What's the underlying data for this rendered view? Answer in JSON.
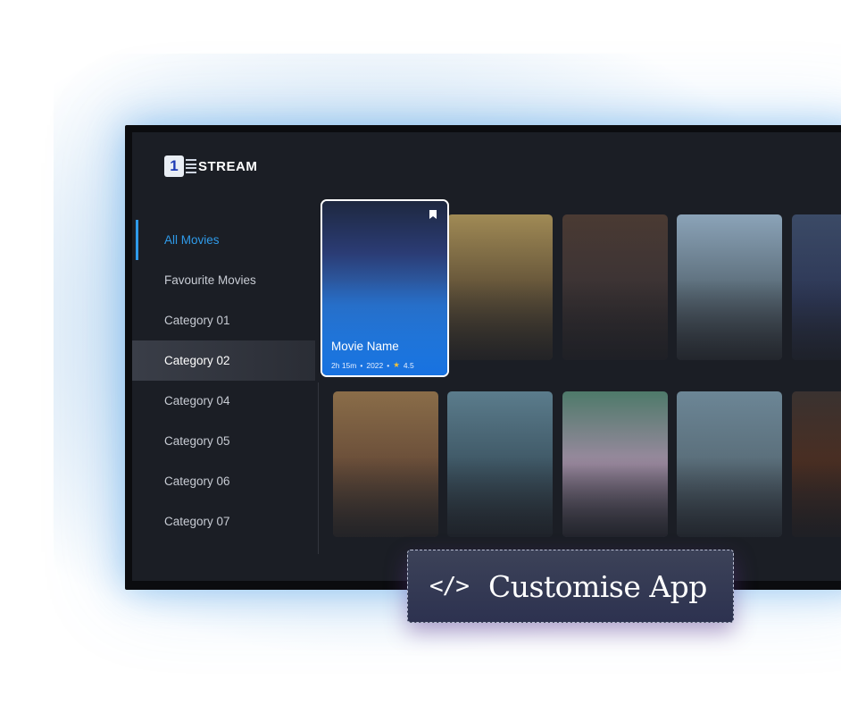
{
  "app": {
    "logo_badge": "1",
    "logo_text": "STREAM"
  },
  "sidebar": {
    "items": [
      {
        "label": "All Movies"
      },
      {
        "label": "Favourite Movies"
      },
      {
        "label": "Category 01"
      },
      {
        "label": "Category 02"
      },
      {
        "label": "Category 04"
      },
      {
        "label": "Category 05"
      },
      {
        "label": "Category 06"
      },
      {
        "label": "Category 07"
      }
    ]
  },
  "featured": {
    "title": "Movie Name",
    "duration": "2h 15m",
    "year": "2022",
    "rating": "4.5",
    "bookmark_icon": "bookmark-icon",
    "star_icon": "star-icon"
  },
  "cta": {
    "icon": "code-icon",
    "icon_glyph": "</>",
    "label": "Customise App"
  },
  "colors": {
    "accent": "#2f9bea",
    "screen_bg": "#1b1e25",
    "featured_blue": "#2b86dc"
  }
}
